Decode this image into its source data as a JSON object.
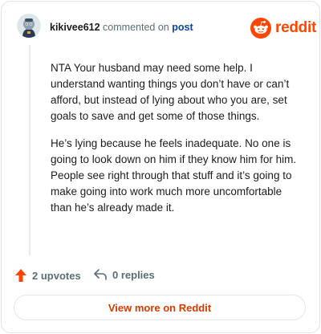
{
  "comment": {
    "username": "kikivee612",
    "action": "commented on",
    "link_label": "post",
    "paragraphs": [
      "NTA Your husband may need some help. I understand wanting things you don’t have or can’t afford, but instead of lying about who you are, set goals to save and get some of those things.",
      "He’s lying because he feels inadequate. No one is going to look down on him if they know him for him. People see right through that stuff and it’s going to make going into work much more uncomfortable than he’s already made it."
    ]
  },
  "brand": {
    "name": "reddit",
    "color": "#ff4500"
  },
  "stats": {
    "upvotes": "2 upvotes",
    "replies": "0 replies"
  },
  "cta": {
    "label": "View more on Reddit"
  },
  "icons": {
    "avatar": "avatar-icon",
    "upvote": "upvote-arrow-icon",
    "reply": "reply-arrow-icon",
    "logo": "reddit-alien-icon"
  }
}
